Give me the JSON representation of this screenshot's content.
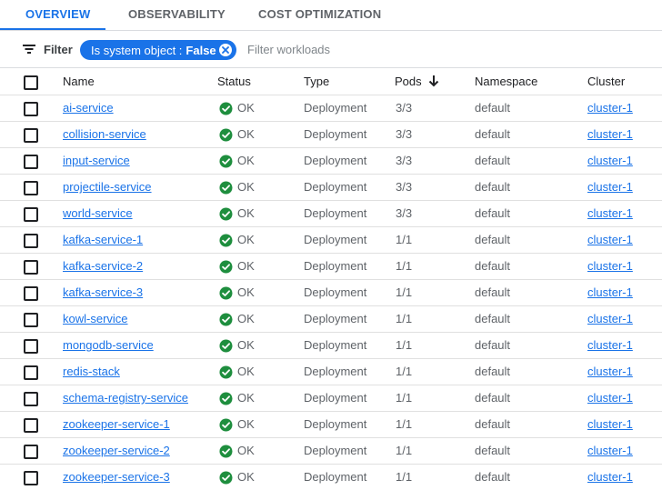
{
  "tabs": [
    {
      "label": "OVERVIEW",
      "active": true
    },
    {
      "label": "OBSERVABILITY",
      "active": false
    },
    {
      "label": "COST OPTIMIZATION",
      "active": false
    }
  ],
  "filterbar": {
    "filter_label": "Filter",
    "chip_key": "Is system object :",
    "chip_value": "False",
    "placeholder": "Filter workloads"
  },
  "table": {
    "headers": {
      "name": "Name",
      "status": "Status",
      "type": "Type",
      "pods": "Pods",
      "namespace": "Namespace",
      "cluster": "Cluster"
    },
    "sort": {
      "column": "pods",
      "direction": "descending",
      "icon": "arrow-down-icon"
    },
    "rows": [
      {
        "name": "ai-service",
        "status": "OK",
        "type": "Deployment",
        "pods": "3/3",
        "namespace": "default",
        "cluster": "cluster-1"
      },
      {
        "name": "collision-service",
        "status": "OK",
        "type": "Deployment",
        "pods": "3/3",
        "namespace": "default",
        "cluster": "cluster-1"
      },
      {
        "name": "input-service",
        "status": "OK",
        "type": "Deployment",
        "pods": "3/3",
        "namespace": "default",
        "cluster": "cluster-1"
      },
      {
        "name": "projectile-service",
        "status": "OK",
        "type": "Deployment",
        "pods": "3/3",
        "namespace": "default",
        "cluster": "cluster-1"
      },
      {
        "name": "world-service",
        "status": "OK",
        "type": "Deployment",
        "pods": "3/3",
        "namespace": "default",
        "cluster": "cluster-1"
      },
      {
        "name": "kafka-service-1",
        "status": "OK",
        "type": "Deployment",
        "pods": "1/1",
        "namespace": "default",
        "cluster": "cluster-1"
      },
      {
        "name": "kafka-service-2",
        "status": "OK",
        "type": "Deployment",
        "pods": "1/1",
        "namespace": "default",
        "cluster": "cluster-1"
      },
      {
        "name": "kafka-service-3",
        "status": "OK",
        "type": "Deployment",
        "pods": "1/1",
        "namespace": "default",
        "cluster": "cluster-1"
      },
      {
        "name": "kowl-service",
        "status": "OK",
        "type": "Deployment",
        "pods": "1/1",
        "namespace": "default",
        "cluster": "cluster-1"
      },
      {
        "name": "mongodb-service",
        "status": "OK",
        "type": "Deployment",
        "pods": "1/1",
        "namespace": "default",
        "cluster": "cluster-1"
      },
      {
        "name": "redis-stack",
        "status": "OK",
        "type": "Deployment",
        "pods": "1/1",
        "namespace": "default",
        "cluster": "cluster-1"
      },
      {
        "name": "schema-registry-service",
        "status": "OK",
        "type": "Deployment",
        "pods": "1/1",
        "namespace": "default",
        "cluster": "cluster-1"
      },
      {
        "name": "zookeeper-service-1",
        "status": "OK",
        "type": "Deployment",
        "pods": "1/1",
        "namespace": "default",
        "cluster": "cluster-1"
      },
      {
        "name": "zookeeper-service-2",
        "status": "OK",
        "type": "Deployment",
        "pods": "1/1",
        "namespace": "default",
        "cluster": "cluster-1"
      },
      {
        "name": "zookeeper-service-3",
        "status": "OK",
        "type": "Deployment",
        "pods": "1/1",
        "namespace": "default",
        "cluster": "cluster-1"
      }
    ]
  },
  "icons": {
    "filter": "filter-list-icon",
    "chip_remove": "cancel-icon",
    "status_ok": "check-circle-icon"
  },
  "colors": {
    "accent": "#1a73e8",
    "status_ok": "#1e8e3e"
  }
}
